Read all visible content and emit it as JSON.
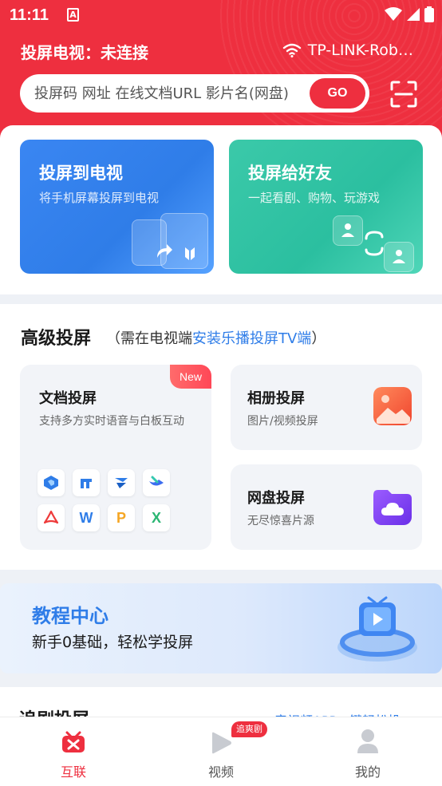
{
  "status_bar": {
    "time": "11:11",
    "app_notification_glyph": "A"
  },
  "header": {
    "connection_title": "投屏电视：未连接",
    "wifi_name": "TP-LINK-Rob…",
    "accent_color": "#ee2f3f"
  },
  "search": {
    "placeholder": "投屏码 网址 在线文档URL 影片名(网盘)",
    "go_label": "GO"
  },
  "cast_cards": [
    {
      "title": "投屏到电视",
      "subtitle": "将手机屏幕投屏到电视",
      "color": "#3a86f2"
    },
    {
      "title": "投屏给好友",
      "subtitle": "一起看剧、购物、玩游戏",
      "color": "#2bbfa0"
    }
  ],
  "advanced": {
    "title": "高级投屏",
    "note_prefix": "（需在电视端",
    "note_link": "安装乐播投屏TV端",
    "note_suffix": "）",
    "doc_card": {
      "title": "文档投屏",
      "description": "支持多方实时语音与白板互动",
      "badge": "New",
      "file_icons": [
        "docs-icon",
        "pages-icon",
        "feishu-icon",
        "lark-icon",
        "pdf-icon",
        "word-icon",
        "ppt-icon",
        "excel-icon"
      ],
      "file_glyphs": [
        "",
        "",
        "",
        "",
        "",
        "W",
        "P",
        "X"
      ]
    },
    "album_card": {
      "title": "相册投屏",
      "description": "图片/视频投屏"
    },
    "cloud_card": {
      "title": "网盘投屏",
      "description": "无尽惊喜片源"
    }
  },
  "tutorial": {
    "title": "教程中心",
    "subtitle": "新手0基础，轻松学投屏"
  },
  "chase": {
    "title": "追剧投屏",
    "link": "音视频APP一键轻松投 ›"
  },
  "tabbar": {
    "tabs": [
      {
        "label": "互联",
        "active": true
      },
      {
        "label": "视频",
        "active": false,
        "badge": "追爽剧"
      },
      {
        "label": "我的",
        "active": false
      }
    ]
  }
}
